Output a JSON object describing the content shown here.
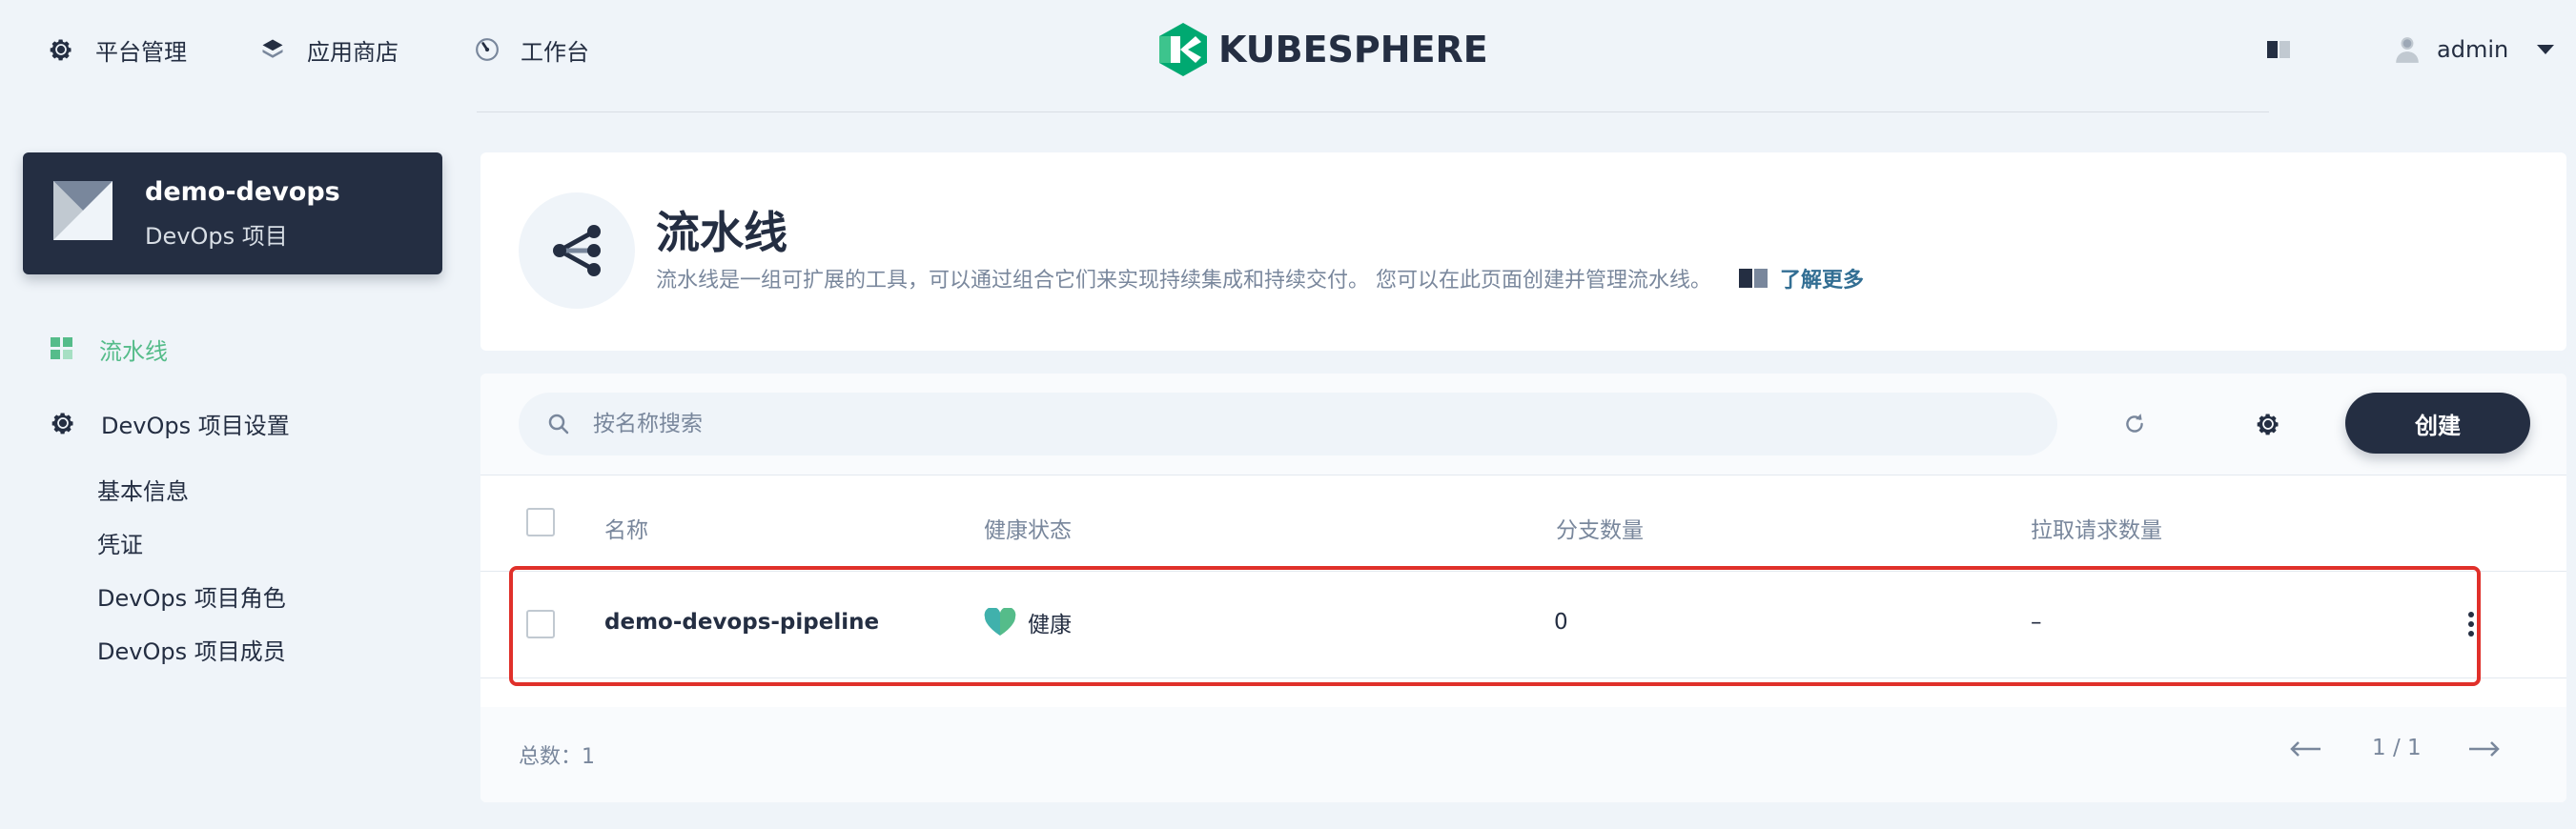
{
  "topnav": {
    "platform_label": "平台管理",
    "appstore_label": "应用商店",
    "workbench_label": "工作台",
    "logo_text": "KUBESPHERE",
    "user_name": "admin"
  },
  "sidebar": {
    "project_name": "demo-devops",
    "project_type": "DevOps 项目",
    "items": [
      {
        "label": "流水线",
        "icon": "pipeline-grid-icon",
        "active": true
      },
      {
        "label": "DevOps 项目设置",
        "icon": "gear-icon"
      }
    ],
    "settings_children": [
      "基本信息",
      "凭证",
      "DevOps 项目角色",
      "DevOps 项目成员"
    ]
  },
  "banner": {
    "title": "流水线",
    "description": "流水线是一组可扩展的工具，可以通过组合它们来实现持续集成和持续交付。 您可以在此页面创建并管理流水线。",
    "learn_more": "了解更多"
  },
  "toolbar": {
    "search_placeholder": "按名称搜索",
    "create_label": "创建"
  },
  "table": {
    "columns": [
      "名称",
      "健康状态",
      "分支数量",
      "拉取请求数量"
    ],
    "rows": [
      {
        "name": "demo-devops-pipeline",
        "health": "健康",
        "branches": "0",
        "pull_requests": "–"
      }
    ]
  },
  "footer": {
    "total_label": "总数：1",
    "page_indicator": "1 / 1"
  },
  "colors": {
    "primary_dark": "#242e42",
    "accent_green": "#55bc8a",
    "highlight_red": "#e0302a",
    "muted_text": "#79879c"
  }
}
